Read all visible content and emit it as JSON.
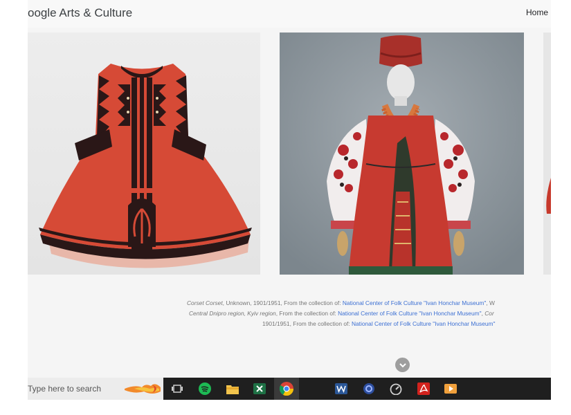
{
  "header": {
    "brand": "oogle Arts & Culture",
    "nav_home": "Home"
  },
  "artworks": [
    {
      "icon": "red-corset-artwork"
    },
    {
      "icon": "costume-on-mannequin-artwork"
    },
    {
      "icon": "partial-artwork"
    }
  ],
  "captions": {
    "line1": {
      "title": "Corset Corset",
      "meta": ", Unknown, 1901/1951, From the collection of: ",
      "link": "National Center of Folk Culture \"Ivan Honchar Museum\"",
      "tail": ", W"
    },
    "line2": {
      "title": "Central Dnipro region, Kyiv region",
      "meta": ", From the collection of: ",
      "link": "National Center of Folk Culture \"Ivan Honchar Museum\"",
      "tail_sep": ", ",
      "tail": "Cor"
    },
    "line3": {
      "meta": "1901/1951, From the collection of: ",
      "link": "National Center of Folk Culture \"Ivan Honchar Museum\""
    }
  },
  "scroll_button": {
    "icon": "chevron-down-icon"
  },
  "taskbar": {
    "search_placeholder": "Type here to search",
    "apps": [
      {
        "name": "task-view-icon"
      },
      {
        "name": "spotify-icon"
      },
      {
        "name": "file-explorer-icon"
      },
      {
        "name": "excel-icon"
      },
      {
        "name": "chrome-icon"
      },
      {
        "name": "word-icon"
      },
      {
        "name": "app-settings-icon"
      },
      {
        "name": "speedometer-icon"
      },
      {
        "name": "acrobat-icon"
      },
      {
        "name": "media-player-icon"
      }
    ]
  },
  "colors": {
    "link": "#3b6fd3",
    "taskbar": "#1f1f1f",
    "corset_red": "#d64a36"
  }
}
